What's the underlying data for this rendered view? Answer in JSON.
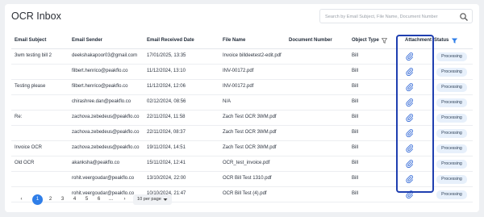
{
  "page": {
    "title": "OCR Inbox"
  },
  "search": {
    "placeholder": "Search by Email Subject, File Name, Document Number"
  },
  "columns": [
    "Email Subject",
    "Email Sender",
    "Email Received Date",
    "File Name",
    "Document Number",
    "Object Type",
    "Attachment",
    "Status"
  ],
  "rows": [
    {
      "subject": "3wm testing bill 2",
      "sender": "deekshakapoor03@gmail.com",
      "date": "17/01/2025, 13:35",
      "file": "Invoice billdeetest2-edit.pdf",
      "doc": "",
      "type": "Bill",
      "status": "Processing"
    },
    {
      "subject": "",
      "sender": "filbert.henrico@peakflo.co",
      "date": "11/12/2024, 13:10",
      "file": "INV-00172.pdf",
      "doc": "",
      "type": "Bill",
      "status": "Processing"
    },
    {
      "subject": "Testing please",
      "sender": "filbert.henrico@peakflo.co",
      "date": "11/12/2024, 12:06",
      "file": "INV-00172.pdf",
      "doc": "",
      "type": "Bill",
      "status": "Processing"
    },
    {
      "subject": "",
      "sender": "chirashree.dan@peakflo.co",
      "date": "02/12/2024, 08:56",
      "file": "N/A",
      "doc": "",
      "type": "Bill",
      "status": "Processing"
    },
    {
      "subject": "Re:",
      "sender": "zachova.zebedeus@peakflo.co",
      "date": "22/11/2024, 11:58",
      "file": "Zach Test OCR 3WM.pdf",
      "doc": "",
      "type": "Bill",
      "status": "Processing"
    },
    {
      "subject": "",
      "sender": "zachova.zebedeus@peakflo.co",
      "date": "22/11/2024, 08:37",
      "file": "Zach Test OCR 3WM.pdf",
      "doc": "",
      "type": "Bill",
      "status": "Processing"
    },
    {
      "subject": "Invoice OCR",
      "sender": "zachova.zebedeus@peakflo.co",
      "date": "19/11/2024, 14:51",
      "file": "Zach Test OCR 3WM.pdf",
      "doc": "",
      "type": "Bill",
      "status": "Processing"
    },
    {
      "subject": "Old OCR",
      "sender": "akanksha@peakflo.co",
      "date": "15/11/2024, 12:41",
      "file": "OCR_test_invoice.pdf",
      "doc": "",
      "type": "Bill",
      "status": "Processing"
    },
    {
      "subject": "",
      "sender": "rohit.veergoudar@peakflo.co",
      "date": "13/10/2024, 22:00",
      "file": "OCR Bill Test 1310.pdf",
      "doc": "",
      "type": "Bill",
      "status": "Processing"
    },
    {
      "subject": "",
      "sender": "rohit.veergoudar@peakflo.co",
      "date": "10/10/2024, 21:47",
      "file": "OCR Bill Test (4).pdf",
      "doc": "",
      "type": "Bill",
      "status": "Processing"
    }
  ],
  "pagination": {
    "prev": "‹",
    "pages": [
      "1",
      "2",
      "3",
      "4",
      "5",
      "6",
      "..."
    ],
    "next": "›",
    "active_page": "1",
    "per_page": "10 per page"
  },
  "icons": {
    "search": "search-icon",
    "filter": "filter-icon",
    "attachment": "paperclip-icon",
    "dropdown": "chevron-down-icon"
  },
  "colors": {
    "accent": "#2f7ee8",
    "highlight_border": "#1f3fb0",
    "status_badge_bg": "#e7f0fb",
    "attachment_icon": "#3b6fd8",
    "status_filter_active": "#2f7ee8"
  }
}
